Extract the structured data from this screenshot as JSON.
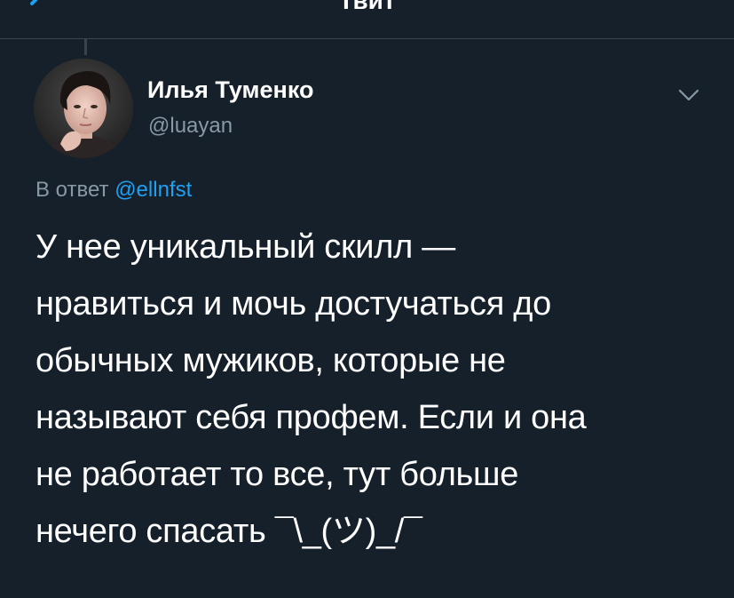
{
  "header": {
    "title": "Твит",
    "back_icon": "chevron-left-icon"
  },
  "tweet": {
    "author": {
      "name": "Илья Туменко",
      "handle": "@luayan"
    },
    "reply": {
      "prefix": "В ответ",
      "mention": "@ellnfst"
    },
    "text_lines": [
      "У нее уникальный скилл —",
      "нравиться и мочь достучаться до",
      "обычных мужиков, которые не",
      "называют себя профем. Если и она",
      "не работает то все, тут больше",
      "нечего спасать ¯\\_(ツ)_/¯"
    ],
    "menu_icon": "chevron-down-icon"
  },
  "colors": {
    "background": "#15202b",
    "divider": "#38444d",
    "text": "#ffffff",
    "secondary": "#8899a6",
    "accent": "#1da1f2"
  }
}
